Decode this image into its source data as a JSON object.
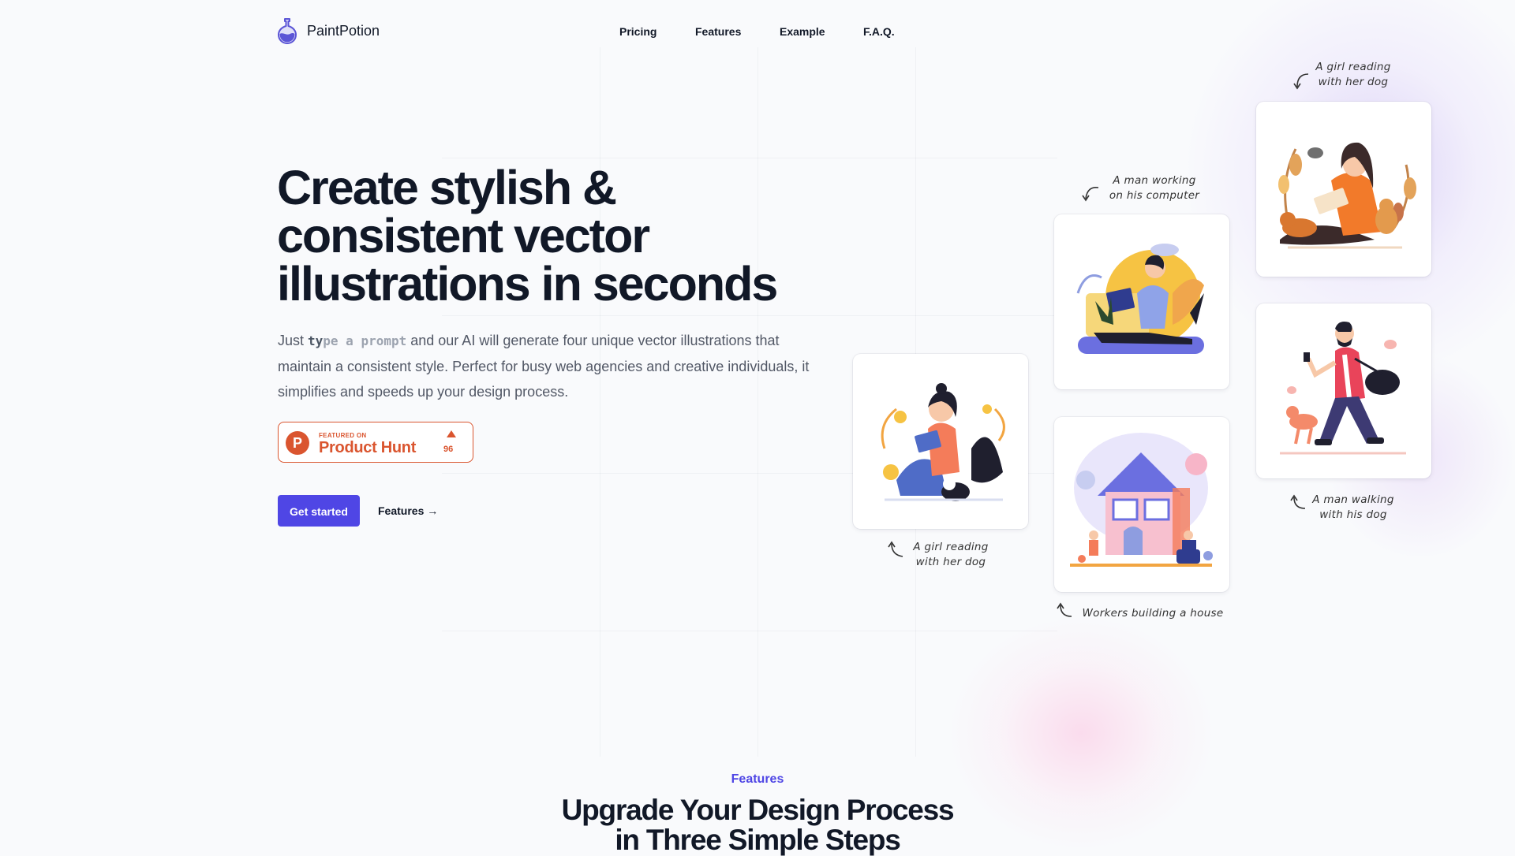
{
  "brand": {
    "name": "PaintPotion",
    "logo_icon": "potion-flask-icon",
    "accent": "#4f46e5"
  },
  "nav": {
    "items": [
      "Pricing",
      "Features",
      "Example",
      "F.A.Q."
    ]
  },
  "hero": {
    "title_lines": [
      "Create stylish &",
      "consistent vector",
      "illustrations in seconds"
    ],
    "desc_prefix": "Just ",
    "typed_done": "ty",
    "typed_rest": "pe a prompt",
    "desc_suffix": " and our AI will generate four unique vector illustrations that maintain a consistent style. Perfect for busy web agencies and creative individuals, it simplifies and speeds up your design process.",
    "product_hunt": {
      "featured": "FEATURED ON",
      "name": "Product Hunt",
      "letter": "P",
      "upvotes": "96",
      "color": "#da552f"
    },
    "cta_primary": "Get started",
    "cta_secondary": "Features →"
  },
  "illustrations": [
    {
      "caption": [
        "A girl reading",
        "with her dog"
      ]
    },
    {
      "caption": [
        "A man working",
        "on his computer"
      ]
    },
    {
      "caption": [
        "Workers building a house"
      ]
    },
    {
      "caption": [
        "A girl reading",
        "with her dog"
      ]
    },
    {
      "caption": [
        "A man walking",
        "with his dog"
      ]
    }
  ],
  "features": {
    "label": "Features",
    "title_lines": [
      "Upgrade Your Design Process",
      "in Three Simple Steps"
    ]
  }
}
